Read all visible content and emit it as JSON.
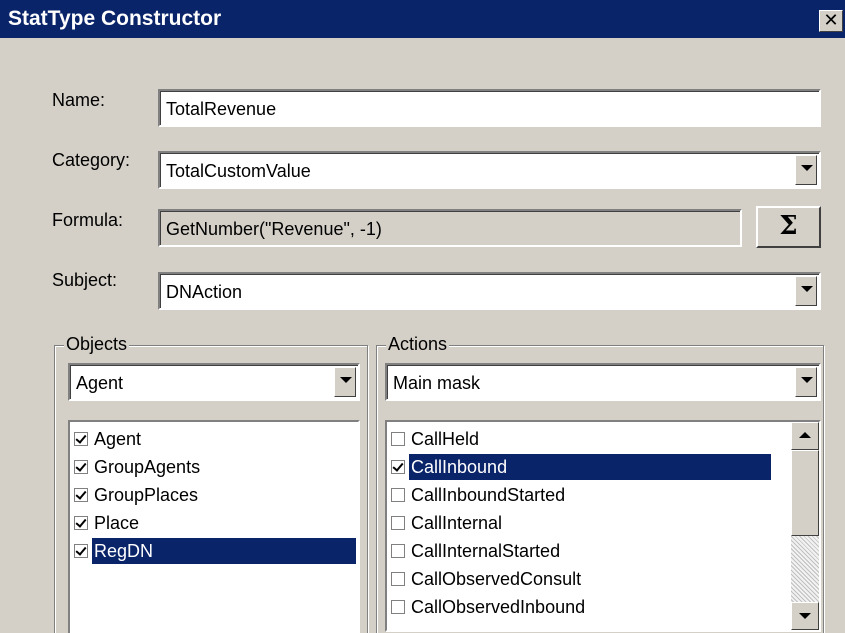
{
  "window": {
    "title": "StatType Constructor",
    "close_glyph": "✕"
  },
  "form": {
    "name_label": "Name:",
    "name_value": "TotalRevenue",
    "category_label": "Category:",
    "category_value": "TotalCustomValue",
    "formula_label": "Formula:",
    "formula_value": "GetNumber(\"Revenue\", -1)",
    "subject_label": "Subject:",
    "subject_value": "DNAction",
    "sigma_glyph": "Σ"
  },
  "objects": {
    "group_label": "Objects",
    "dropdown_value": "Agent",
    "items": [
      {
        "label": "Agent",
        "checked": true,
        "selected": false
      },
      {
        "label": "GroupAgents",
        "checked": true,
        "selected": false
      },
      {
        "label": "GroupPlaces",
        "checked": true,
        "selected": false
      },
      {
        "label": "Place",
        "checked": true,
        "selected": false
      },
      {
        "label": "RegDN",
        "checked": true,
        "selected": true
      }
    ]
  },
  "actions": {
    "group_label": "Actions",
    "dropdown_value": "Main mask",
    "items": [
      {
        "label": "CallHeld",
        "checked": false,
        "selected": false
      },
      {
        "label": "CallInbound",
        "checked": true,
        "selected": true
      },
      {
        "label": "CallInboundStarted",
        "checked": false,
        "selected": false
      },
      {
        "label": "CallInternal",
        "checked": false,
        "selected": false
      },
      {
        "label": "CallInternalStarted",
        "checked": false,
        "selected": false
      },
      {
        "label": "CallObservedConsult",
        "checked": false,
        "selected": false
      },
      {
        "label": "CallObservedInbound",
        "checked": false,
        "selected": false
      }
    ]
  },
  "colors": {
    "title_bg": "#0a246a",
    "face": "#d4d0c8",
    "selection": "#0a246a"
  }
}
